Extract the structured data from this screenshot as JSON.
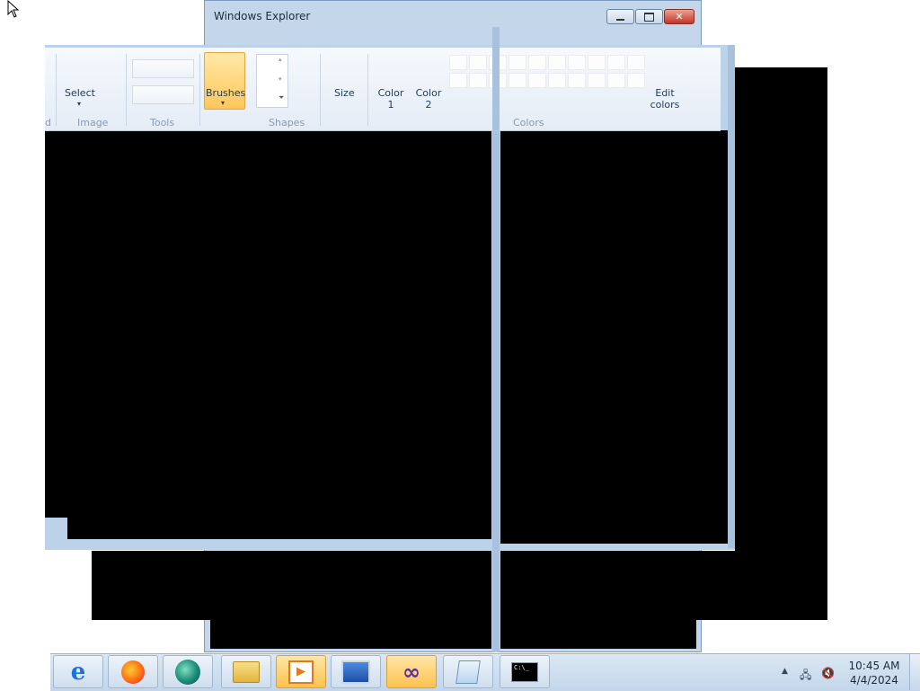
{
  "explorer": {
    "title": "Windows Explorer"
  },
  "ribbon": {
    "partial_group_label": "d",
    "select_label": "Select",
    "image_group_label": "Image",
    "tools_group_label": "Tools",
    "brushes_label": "Brushes",
    "shapes_group_label": "Shapes",
    "size_label": "Size",
    "color1_line1": "Color",
    "color1_line2": "1",
    "color2_line1": "Color",
    "color2_line2": "2",
    "colors_group_label": "Colors",
    "edit_colors_line1": "Edit",
    "edit_colors_line2": "colors"
  },
  "taskbar": {
    "apps": [
      {
        "name": "internet-explorer-icon"
      },
      {
        "name": "firefox-icon"
      },
      {
        "name": "app-icon"
      },
      {
        "name": "file-explorer-icon"
      },
      {
        "name": "media-player-icon"
      },
      {
        "name": "remote-desktop-icon"
      },
      {
        "name": "visual-studio-icon"
      },
      {
        "name": "notepad-icon"
      },
      {
        "name": "command-prompt-icon"
      }
    ],
    "time": "10:45 AM",
    "date": "4/4/2024",
    "cmd_glyph": "C:\\_"
  },
  "colors": {
    "accent": "#ffc75a",
    "title_blue": "#c4d7ea"
  }
}
